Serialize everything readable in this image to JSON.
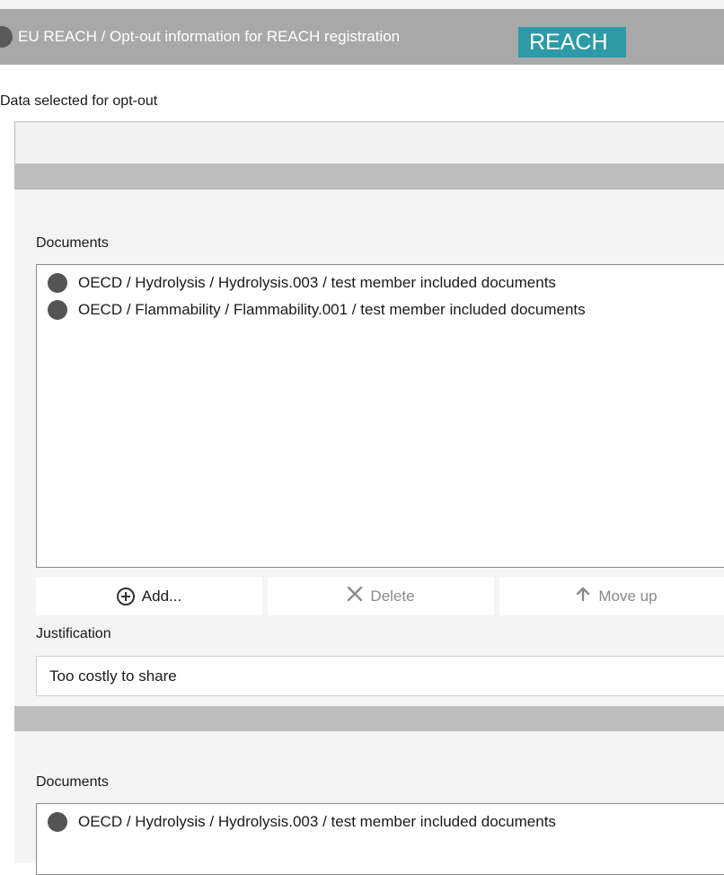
{
  "header": {
    "title": "EU REACH / Opt-out information for REACH registration",
    "tag": "REACH"
  },
  "opt_out": {
    "label": "Data selected for opt-out",
    "value": ""
  },
  "groups": [
    {
      "documents_label": "Documents",
      "documents": [
        "OECD / Hydrolysis / Hydrolysis.003 / test member included documents",
        "OECD / Flammability / Flammability.001 / test member included documents"
      ],
      "buttons": {
        "add": "Add...",
        "delete": "Delete",
        "move_up": "Move up"
      },
      "justification_label": "Justification",
      "justification_value": "Too costly to share"
    },
    {
      "documents_label": "Documents",
      "documents": [
        "OECD / Hydrolysis / Hydrolysis.003 / test member included documents"
      ]
    }
  ],
  "icons": {
    "header_bullet": "bullet-icon",
    "document": "document-bullet-icon",
    "add": "plus-circle-icon",
    "delete": "x-icon",
    "move_up": "arrow-up-icon"
  }
}
